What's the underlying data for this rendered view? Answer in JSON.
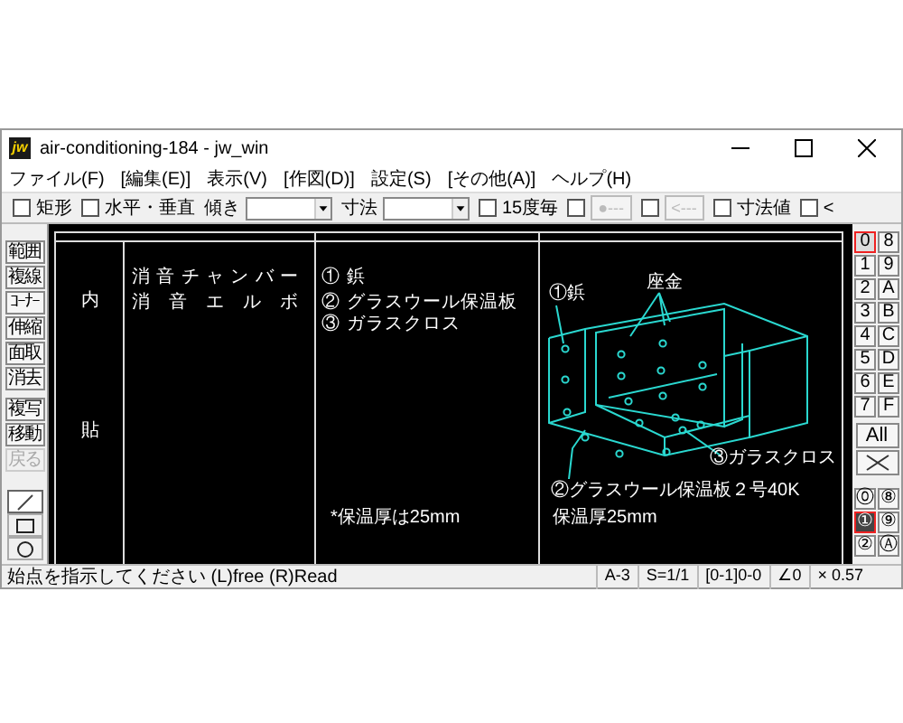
{
  "window": {
    "app_icon": "jw",
    "title": "air-conditioning-184 - jw_win"
  },
  "menu": [
    "ファイル(F)",
    "[編集(E)]",
    "表示(V)",
    "[作図(D)]",
    "設定(S)",
    "[その他(A)]",
    "ヘルプ(H)"
  ],
  "toolbar": [
    {
      "kind": "checkbox",
      "label": "矩形",
      "checked": false
    },
    {
      "kind": "checkbox",
      "label": "水平・垂直",
      "checked": false
    },
    {
      "kind": "dropdown",
      "label": "傾き"
    },
    {
      "kind": "dropdown",
      "label": "寸法"
    },
    {
      "kind": "checkbox",
      "label": "15度毎",
      "checked": false
    },
    {
      "kind": "checkbutton",
      "checked": false,
      "button": "●---",
      "disabled": true
    },
    {
      "kind": "checkbutton",
      "checked": false,
      "button": "<---",
      "disabled": true
    },
    {
      "kind": "checkbox",
      "label": "寸法値",
      "checked": false
    },
    {
      "kind": "checkbox",
      "label": "<",
      "checked": false
    }
  ],
  "tools": [
    {
      "label": "範囲",
      "disabled": false
    },
    {
      "label": "複線",
      "disabled": false
    },
    {
      "label": "ｺｰﾅｰ",
      "disabled": false
    },
    {
      "label": "伸縮",
      "disabled": false
    },
    {
      "label": "面取",
      "disabled": false
    },
    {
      "label": "消去",
      "disabled": false
    },
    {
      "label": "複写",
      "disabled": false
    },
    {
      "label": "移動",
      "disabled": false
    },
    {
      "label": "戻る",
      "disabled": true
    }
  ],
  "draw_tools": [
    {
      "kind": "line",
      "selected": true
    },
    {
      "kind": "rect",
      "selected": false
    },
    {
      "kind": "circle",
      "selected": false
    }
  ],
  "canvas": {
    "row_labels": [
      "内",
      "貼"
    ],
    "items": [
      "消音チャンバー",
      "消音エルボ"
    ],
    "materials": [
      "① 鋲",
      "② グラスウール保温板",
      "③ ガラスクロス"
    ],
    "note": "*保温厚は25mm",
    "drawing_labels": [
      "①鋲",
      "座金",
      "③ガラスクロス",
      "②グラスウール保温板２号40K",
      "保温厚25mm"
    ]
  },
  "layers": [
    {
      "label": "0",
      "selected": true
    },
    {
      "label": "8",
      "selected": false
    },
    {
      "label": "1",
      "selected": false
    },
    {
      "label": "9",
      "selected": false
    },
    {
      "label": "2",
      "selected": false
    },
    {
      "label": "A",
      "selected": false
    },
    {
      "label": "3",
      "selected": false
    },
    {
      "label": "B",
      "selected": false
    },
    {
      "label": "4",
      "selected": false
    },
    {
      "label": "C",
      "selected": false
    },
    {
      "label": "5",
      "selected": false
    },
    {
      "label": "D",
      "selected": false
    },
    {
      "label": "6",
      "selected": false
    },
    {
      "label": "E",
      "selected": false
    },
    {
      "label": "7",
      "selected": false
    },
    {
      "label": "F",
      "selected": false
    }
  ],
  "layer_all": "All",
  "layer_groups": [
    {
      "label": "⓪",
      "selected": false
    },
    {
      "label": "⑧",
      "selected": false
    },
    {
      "label": "①",
      "selected": true
    },
    {
      "label": "⑨",
      "selected": false
    },
    {
      "label": "②",
      "selected": false
    },
    {
      "label": "Ⓐ",
      "selected": false
    }
  ],
  "status_bar": {
    "message": "始点を指示してください (L)free (R)Read",
    "fields": [
      "A-3",
      "S=1/1",
      "[0-1]0-0",
      "∠0",
      "× 0.57"
    ]
  }
}
